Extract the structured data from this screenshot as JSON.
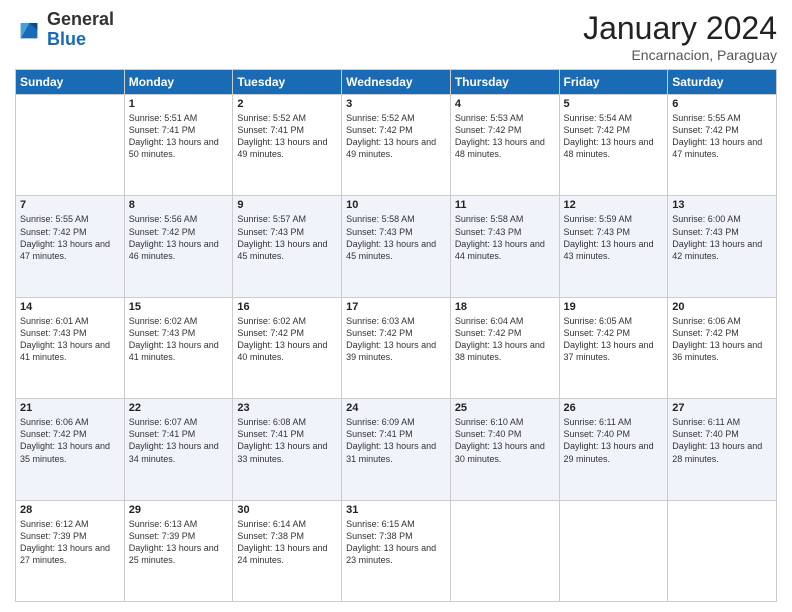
{
  "logo": {
    "general": "General",
    "blue": "Blue"
  },
  "title": "January 2024",
  "location": "Encarnacion, Paraguay",
  "days_header": [
    "Sunday",
    "Monday",
    "Tuesday",
    "Wednesday",
    "Thursday",
    "Friday",
    "Saturday"
  ],
  "weeks": [
    [
      {
        "day": "",
        "sunrise": "",
        "sunset": "",
        "daylight": ""
      },
      {
        "day": "1",
        "sunrise": "Sunrise: 5:51 AM",
        "sunset": "Sunset: 7:41 PM",
        "daylight": "Daylight: 13 hours and 50 minutes."
      },
      {
        "day": "2",
        "sunrise": "Sunrise: 5:52 AM",
        "sunset": "Sunset: 7:41 PM",
        "daylight": "Daylight: 13 hours and 49 minutes."
      },
      {
        "day": "3",
        "sunrise": "Sunrise: 5:52 AM",
        "sunset": "Sunset: 7:42 PM",
        "daylight": "Daylight: 13 hours and 49 minutes."
      },
      {
        "day": "4",
        "sunrise": "Sunrise: 5:53 AM",
        "sunset": "Sunset: 7:42 PM",
        "daylight": "Daylight: 13 hours and 48 minutes."
      },
      {
        "day": "5",
        "sunrise": "Sunrise: 5:54 AM",
        "sunset": "Sunset: 7:42 PM",
        "daylight": "Daylight: 13 hours and 48 minutes."
      },
      {
        "day": "6",
        "sunrise": "Sunrise: 5:55 AM",
        "sunset": "Sunset: 7:42 PM",
        "daylight": "Daylight: 13 hours and 47 minutes."
      }
    ],
    [
      {
        "day": "7",
        "sunrise": "Sunrise: 5:55 AM",
        "sunset": "Sunset: 7:42 PM",
        "daylight": "Daylight: 13 hours and 47 minutes."
      },
      {
        "day": "8",
        "sunrise": "Sunrise: 5:56 AM",
        "sunset": "Sunset: 7:42 PM",
        "daylight": "Daylight: 13 hours and 46 minutes."
      },
      {
        "day": "9",
        "sunrise": "Sunrise: 5:57 AM",
        "sunset": "Sunset: 7:43 PM",
        "daylight": "Daylight: 13 hours and 45 minutes."
      },
      {
        "day": "10",
        "sunrise": "Sunrise: 5:58 AM",
        "sunset": "Sunset: 7:43 PM",
        "daylight": "Daylight: 13 hours and 45 minutes."
      },
      {
        "day": "11",
        "sunrise": "Sunrise: 5:58 AM",
        "sunset": "Sunset: 7:43 PM",
        "daylight": "Daylight: 13 hours and 44 minutes."
      },
      {
        "day": "12",
        "sunrise": "Sunrise: 5:59 AM",
        "sunset": "Sunset: 7:43 PM",
        "daylight": "Daylight: 13 hours and 43 minutes."
      },
      {
        "day": "13",
        "sunrise": "Sunrise: 6:00 AM",
        "sunset": "Sunset: 7:43 PM",
        "daylight": "Daylight: 13 hours and 42 minutes."
      }
    ],
    [
      {
        "day": "14",
        "sunrise": "Sunrise: 6:01 AM",
        "sunset": "Sunset: 7:43 PM",
        "daylight": "Daylight: 13 hours and 41 minutes."
      },
      {
        "day": "15",
        "sunrise": "Sunrise: 6:02 AM",
        "sunset": "Sunset: 7:43 PM",
        "daylight": "Daylight: 13 hours and 41 minutes."
      },
      {
        "day": "16",
        "sunrise": "Sunrise: 6:02 AM",
        "sunset": "Sunset: 7:42 PM",
        "daylight": "Daylight: 13 hours and 40 minutes."
      },
      {
        "day": "17",
        "sunrise": "Sunrise: 6:03 AM",
        "sunset": "Sunset: 7:42 PM",
        "daylight": "Daylight: 13 hours and 39 minutes."
      },
      {
        "day": "18",
        "sunrise": "Sunrise: 6:04 AM",
        "sunset": "Sunset: 7:42 PM",
        "daylight": "Daylight: 13 hours and 38 minutes."
      },
      {
        "day": "19",
        "sunrise": "Sunrise: 6:05 AM",
        "sunset": "Sunset: 7:42 PM",
        "daylight": "Daylight: 13 hours and 37 minutes."
      },
      {
        "day": "20",
        "sunrise": "Sunrise: 6:06 AM",
        "sunset": "Sunset: 7:42 PM",
        "daylight": "Daylight: 13 hours and 36 minutes."
      }
    ],
    [
      {
        "day": "21",
        "sunrise": "Sunrise: 6:06 AM",
        "sunset": "Sunset: 7:42 PM",
        "daylight": "Daylight: 13 hours and 35 minutes."
      },
      {
        "day": "22",
        "sunrise": "Sunrise: 6:07 AM",
        "sunset": "Sunset: 7:41 PM",
        "daylight": "Daylight: 13 hours and 34 minutes."
      },
      {
        "day": "23",
        "sunrise": "Sunrise: 6:08 AM",
        "sunset": "Sunset: 7:41 PM",
        "daylight": "Daylight: 13 hours and 33 minutes."
      },
      {
        "day": "24",
        "sunrise": "Sunrise: 6:09 AM",
        "sunset": "Sunset: 7:41 PM",
        "daylight": "Daylight: 13 hours and 31 minutes."
      },
      {
        "day": "25",
        "sunrise": "Sunrise: 6:10 AM",
        "sunset": "Sunset: 7:40 PM",
        "daylight": "Daylight: 13 hours and 30 minutes."
      },
      {
        "day": "26",
        "sunrise": "Sunrise: 6:11 AM",
        "sunset": "Sunset: 7:40 PM",
        "daylight": "Daylight: 13 hours and 29 minutes."
      },
      {
        "day": "27",
        "sunrise": "Sunrise: 6:11 AM",
        "sunset": "Sunset: 7:40 PM",
        "daylight": "Daylight: 13 hours and 28 minutes."
      }
    ],
    [
      {
        "day": "28",
        "sunrise": "Sunrise: 6:12 AM",
        "sunset": "Sunset: 7:39 PM",
        "daylight": "Daylight: 13 hours and 27 minutes."
      },
      {
        "day": "29",
        "sunrise": "Sunrise: 6:13 AM",
        "sunset": "Sunset: 7:39 PM",
        "daylight": "Daylight: 13 hours and 25 minutes."
      },
      {
        "day": "30",
        "sunrise": "Sunrise: 6:14 AM",
        "sunset": "Sunset: 7:38 PM",
        "daylight": "Daylight: 13 hours and 24 minutes."
      },
      {
        "day": "31",
        "sunrise": "Sunrise: 6:15 AM",
        "sunset": "Sunset: 7:38 PM",
        "daylight": "Daylight: 13 hours and 23 minutes."
      },
      {
        "day": "",
        "sunrise": "",
        "sunset": "",
        "daylight": ""
      },
      {
        "day": "",
        "sunrise": "",
        "sunset": "",
        "daylight": ""
      },
      {
        "day": "",
        "sunrise": "",
        "sunset": "",
        "daylight": ""
      }
    ]
  ]
}
